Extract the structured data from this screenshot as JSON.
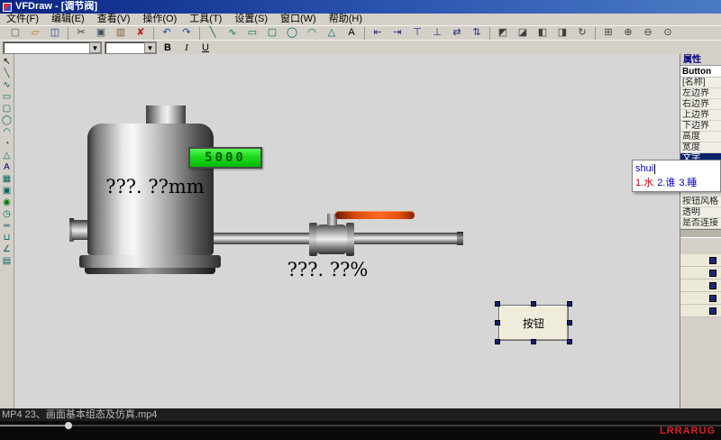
{
  "window": {
    "title": "VFDraw - [调节阀]"
  },
  "menubar": {
    "items": [
      {
        "label": "文件(F)",
        "name": "file"
      },
      {
        "label": "编辑(E)",
        "name": "edit"
      },
      {
        "label": "查看(V)",
        "name": "view"
      },
      {
        "label": "操作(O)",
        "name": "operate"
      },
      {
        "label": "工具(T)",
        "name": "tools"
      },
      {
        "label": "设置(S)",
        "name": "settings"
      },
      {
        "label": "窗口(W)",
        "name": "window"
      },
      {
        "label": "帮助(H)",
        "name": "help"
      }
    ]
  },
  "toolbar": {
    "groups": [
      [
        {
          "name": "new",
          "glyph": "▢",
          "color": "#506070"
        },
        {
          "name": "open",
          "glyph": "▱",
          "color": "#b08000"
        },
        {
          "name": "save",
          "glyph": "◫",
          "color": "#2040a0"
        }
      ],
      [
        {
          "name": "cut",
          "glyph": "✂",
          "color": "#404040"
        },
        {
          "name": "copy",
          "glyph": "▣",
          "color": "#405060"
        },
        {
          "name": "paste",
          "glyph": "▥",
          "color": "#806040"
        },
        {
          "name": "delete",
          "glyph": "✘",
          "color": "#c02020"
        }
      ],
      [
        {
          "name": "undo",
          "glyph": "↶",
          "color": "#2040a0"
        },
        {
          "name": "redo",
          "glyph": "↷",
          "color": "#2040a0"
        }
      ],
      [
        {
          "name": "line",
          "glyph": "╲",
          "color": "#006666"
        },
        {
          "name": "polyline",
          "glyph": "∿",
          "color": "#006666"
        },
        {
          "name": "rect",
          "glyph": "▭",
          "color": "#006666"
        },
        {
          "name": "round-rect",
          "glyph": "▢",
          "color": "#006666"
        },
        {
          "name": "ellipse",
          "glyph": "◯",
          "color": "#006666"
        },
        {
          "name": "arc",
          "glyph": "◠",
          "color": "#006666"
        },
        {
          "name": "polygon",
          "glyph": "△",
          "color": "#006666"
        },
        {
          "name": "text",
          "glyph": "A",
          "color": "#000000"
        }
      ],
      [
        {
          "name": "align-left",
          "glyph": "⇤",
          "color": "#203080"
        },
        {
          "name": "align-right",
          "glyph": "⇥",
          "color": "#203080"
        },
        {
          "name": "align-top",
          "glyph": "⊤",
          "color": "#203080"
        },
        {
          "name": "align-bottom",
          "glyph": "⊥",
          "color": "#203080"
        },
        {
          "name": "same-width",
          "glyph": "⇄",
          "color": "#203080"
        },
        {
          "name": "same-height",
          "glyph": "⇅",
          "color": "#203080"
        }
      ],
      [
        {
          "name": "bring-front",
          "glyph": "◩",
          "color": "#404040"
        },
        {
          "name": "send-back",
          "glyph": "◪",
          "color": "#404040"
        },
        {
          "name": "flip-h",
          "glyph": "◧",
          "color": "#404040"
        },
        {
          "name": "flip-v",
          "glyph": "◨",
          "color": "#404040"
        },
        {
          "name": "rotate",
          "glyph": "↻",
          "color": "#404040"
        }
      ],
      [
        {
          "name": "grid",
          "glyph": "⊞",
          "color": "#404040"
        },
        {
          "name": "zoom-in",
          "glyph": "⊕",
          "color": "#404040"
        },
        {
          "name": "zoom-out",
          "glyph": "⊖",
          "color": "#404040"
        },
        {
          "name": "zoom-fit",
          "glyph": "⊙",
          "color": "#404040"
        }
      ]
    ]
  },
  "fontbar": {
    "font_value": "",
    "size_value": "",
    "bold": "B",
    "italic": "I",
    "underline": "U"
  },
  "icons": {
    "dropdown_arrow": "▼"
  },
  "palette": {
    "items": [
      {
        "name": "select",
        "glyph": "↖",
        "color": "#000000"
      },
      {
        "name": "line",
        "glyph": "╲"
      },
      {
        "name": "polyline",
        "glyph": "∿"
      },
      {
        "name": "rect",
        "glyph": "▭"
      },
      {
        "name": "round-rect",
        "glyph": "▢"
      },
      {
        "name": "ellipse",
        "glyph": "◯"
      },
      {
        "name": "arc",
        "glyph": "◠"
      },
      {
        "name": "pie",
        "glyph": "◔"
      },
      {
        "name": "polygon",
        "glyph": "△"
      },
      {
        "name": "text",
        "glyph": "A",
        "color": "#000080"
      },
      {
        "name": "image",
        "glyph": "▦"
      },
      {
        "name": "button",
        "glyph": "▣"
      },
      {
        "name": "led",
        "glyph": "◉",
        "color": "#007700"
      },
      {
        "name": "meter",
        "glyph": "◷"
      },
      {
        "name": "pipe",
        "glyph": "═"
      },
      {
        "name": "tank",
        "glyph": "⊔"
      },
      {
        "name": "trend",
        "glyph": "∠"
      },
      {
        "name": "table",
        "glyph": "▤"
      }
    ]
  },
  "canvas": {
    "tank": {
      "display_value": "5000",
      "reading": "???. ??mm"
    },
    "valve": {
      "reading": "???. ??%"
    },
    "button_widget": {
      "label": "按钮"
    }
  },
  "properties": {
    "tab": "属性",
    "object": "Button",
    "rows": [
      {
        "label": "[名称]",
        "name": "prop-name"
      },
      {
        "label": "左边界",
        "name": "left-bound"
      },
      {
        "label": "右边界",
        "name": "right-bound"
      },
      {
        "label": "上边界",
        "name": "top-bound"
      },
      {
        "label": "下边界",
        "name": "bottom-bound"
      },
      {
        "label": "高度",
        "name": "height"
      },
      {
        "label": "宽度",
        "name": "width"
      },
      {
        "label": "文字",
        "name": "text",
        "class": "selected"
      },
      {
        "label": "",
        "name": "hidden-1"
      },
      {
        "label": "",
        "name": "hidden-2"
      },
      {
        "label": "",
        "name": "hidden-3"
      },
      {
        "label": "按钮风格",
        "name": "button-style"
      },
      {
        "label": "透明",
        "name": "transparent"
      },
      {
        "label": "是否连接",
        "name": "is-connected"
      }
    ],
    "button_rows": [
      {
        "label": ""
      },
      {
        "label": ""
      },
      {
        "label": ""
      },
      {
        "label": ""
      },
      {
        "label": ""
      }
    ]
  },
  "ime": {
    "composition": "shui",
    "candidates": [
      {
        "label": "1.水",
        "class": "first",
        "name": "cand-1"
      },
      {
        "label": "2.谁",
        "name": "cand-2"
      },
      {
        "label": "3.睡",
        "name": "cand-3"
      }
    ]
  },
  "media": {
    "filename": "MP4 23、画面基本组态及仿真.mp4"
  },
  "watermark": {
    "text": "LRRARUG"
  }
}
